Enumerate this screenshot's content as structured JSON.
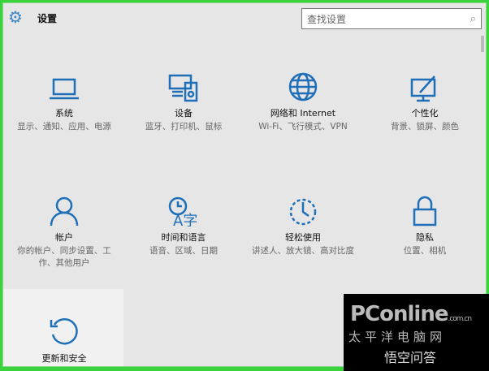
{
  "header": {
    "title": "设置",
    "search_placeholder": "查找设置"
  },
  "tiles": [
    {
      "label": "系统",
      "desc": "显示、通知、应用、电源",
      "icon": "laptop-icon"
    },
    {
      "label": "设备",
      "desc": "蓝牙、打印机、鼠标",
      "icon": "devices-icon"
    },
    {
      "label": "网络和 Internet",
      "desc": "Wi-Fi、飞行模式、VPN",
      "icon": "globe-icon"
    },
    {
      "label": "个性化",
      "desc": "背景、锁屏、颜色",
      "icon": "personalization-icon"
    },
    {
      "label": "帐户",
      "desc": "你的帐户、同步设置、工作、其他用户",
      "icon": "person-icon"
    },
    {
      "label": "时间和语言",
      "desc": "语音、区域、日期",
      "icon": "time-language-icon"
    },
    {
      "label": "轻松使用",
      "desc": "讲述人、放大镜、高对比度",
      "icon": "ease-of-access-icon"
    },
    {
      "label": "隐私",
      "desc": "位置、相机",
      "icon": "lock-icon"
    },
    {
      "label": "更新和安全",
      "desc": "",
      "icon": "update-icon"
    }
  ],
  "watermark": {
    "brand": "PConline",
    "domain": ".com.cn",
    "cn_name": "太平洋电脑网",
    "qa": "悟空问答"
  },
  "colors": {
    "accent": "#1f6fb8",
    "border": "#3bd33b",
    "background": "#e6e6e6"
  }
}
